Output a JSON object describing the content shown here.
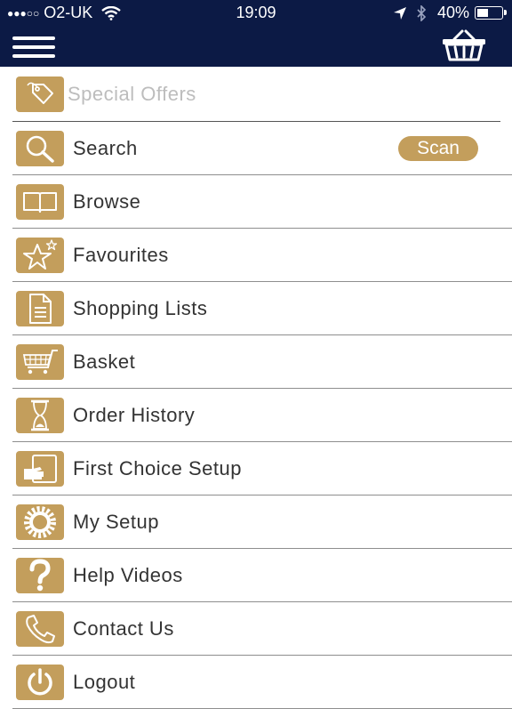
{
  "status_bar": {
    "signal_dots": "●●●○○",
    "carrier": "O2-UK",
    "time": "19:09",
    "battery": "40%",
    "battery_level": 0.4
  },
  "nav": {
    "menu_icon": "hamburger-icon",
    "basket_icon": "basket-icon"
  },
  "menu": {
    "special_offers": "Special Offers",
    "search": "Search",
    "scan": "Scan",
    "browse": "Browse",
    "favourites": "Favourites",
    "shopping_lists": "Shopping Lists",
    "basket": "Basket",
    "order_history": "Order History",
    "first_choice_setup": "First Choice Setup",
    "my_setup": "My Setup",
    "help_videos": "Help Videos",
    "contact_us": "Contact Us",
    "logout": "Logout"
  },
  "colors": {
    "navbar": "#0c1a45",
    "accent_gold": "#c39e5c",
    "text": "#333333"
  }
}
